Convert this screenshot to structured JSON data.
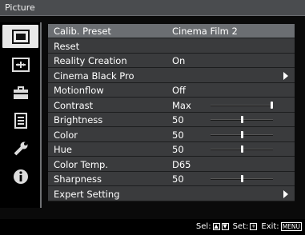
{
  "window": {
    "title": "Picture"
  },
  "sidebar": {
    "tabs": [
      {
        "icon": "picture-icon",
        "active": true
      },
      {
        "icon": "screen-icon",
        "active": false
      },
      {
        "icon": "setup-icon",
        "active": false
      },
      {
        "icon": "function-icon",
        "active": false
      },
      {
        "icon": "installation-icon",
        "active": false
      },
      {
        "icon": "information-icon",
        "active": false
      }
    ]
  },
  "menu": {
    "rows": [
      {
        "label": "Calib. Preset",
        "value": "Cinema Film 2",
        "selected": true
      },
      {
        "label": "Reset",
        "value": ""
      },
      {
        "label": "Reality Creation",
        "value": "On"
      },
      {
        "label": "Cinema Black Pro",
        "value": "",
        "submenu": true
      },
      {
        "label": "Motionflow",
        "value": "Off"
      },
      {
        "label": "Contrast",
        "value": "Max",
        "level": 1.0
      },
      {
        "label": "Brightness",
        "value": "50",
        "level": 0.5
      },
      {
        "label": "Color",
        "value": "50",
        "level": 0.5
      },
      {
        "label": "Hue",
        "value": "50",
        "level": 0.5
      },
      {
        "label": "Color Temp.",
        "value": "D65"
      },
      {
        "label": "Sharpness",
        "value": "50",
        "level": 0.5
      },
      {
        "label": "Expert Setting",
        "value": "",
        "submenu": true
      }
    ]
  },
  "footer": {
    "sel_label": "Sel:",
    "set_label": "Set:",
    "exit_label": "Exit:",
    "menu_key": "MENU"
  }
}
